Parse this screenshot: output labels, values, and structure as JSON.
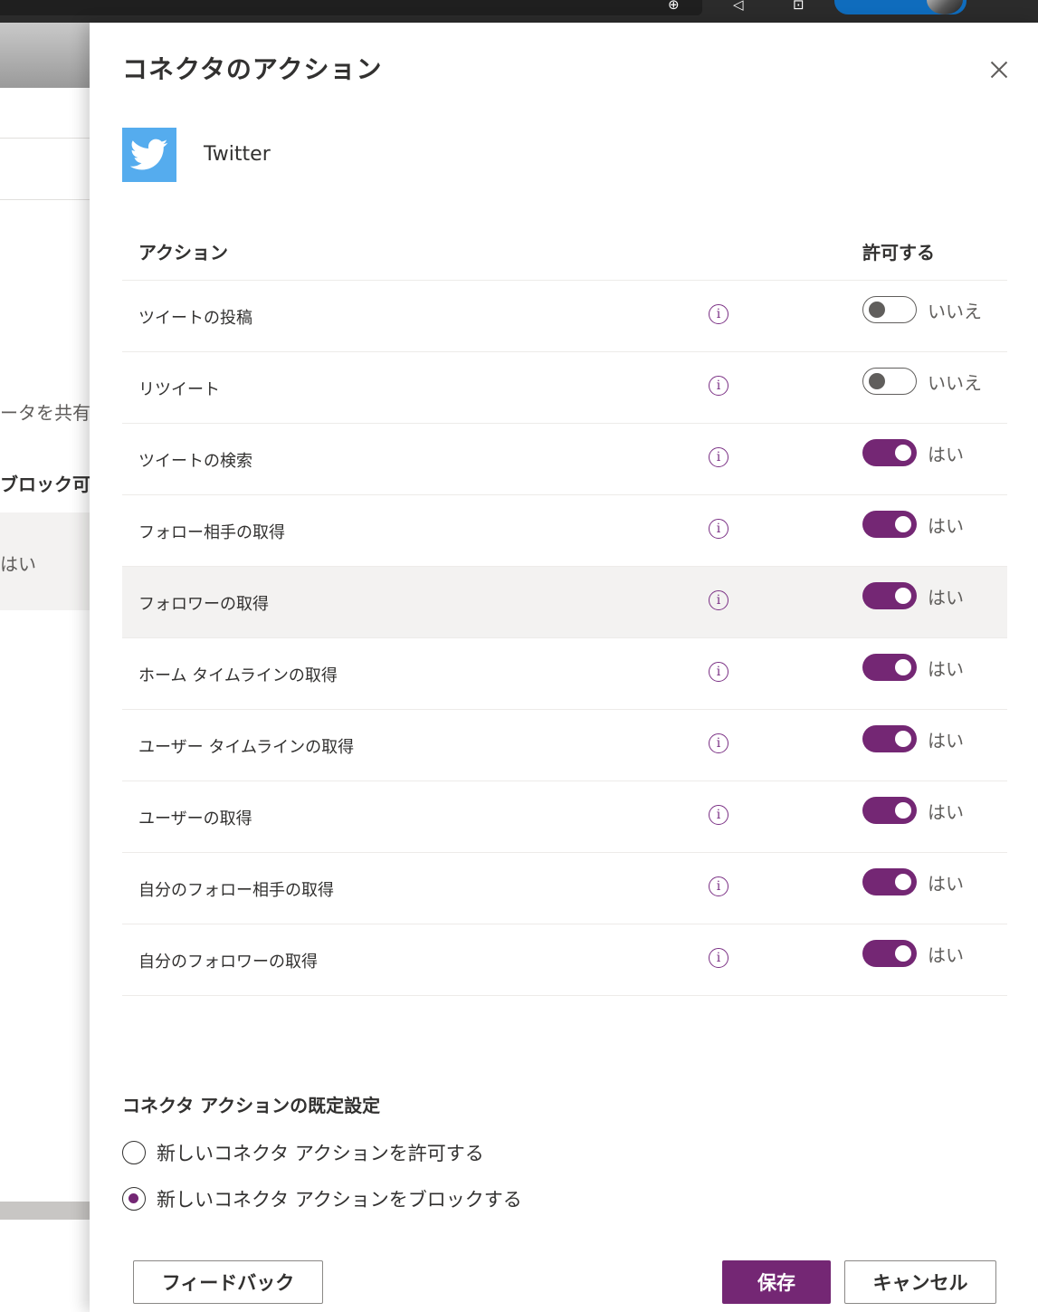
{
  "background": {
    "texts": [
      "ータを共有",
      "ブロック可",
      "はい"
    ]
  },
  "panel": {
    "title": "コネクタのアクション",
    "connector": {
      "name": "Twitter",
      "logo_icon": "twitter-bird-icon",
      "logo_color": "#55acee"
    },
    "table": {
      "header_action": "アクション",
      "header_allow": "許可する",
      "rows": [
        {
          "name": "ツイートの投稿",
          "allowed": false,
          "state_label": "いいえ"
        },
        {
          "name": "リツイート",
          "allowed": false,
          "state_label": "いいえ"
        },
        {
          "name": "ツイートの検索",
          "allowed": true,
          "state_label": "はい"
        },
        {
          "name": "フォロー相手の取得",
          "allowed": true,
          "state_label": "はい"
        },
        {
          "name": "フォロワーの取得",
          "allowed": true,
          "state_label": "はい"
        },
        {
          "name": "ホーム タイムラインの取得",
          "allowed": true,
          "state_label": "はい"
        },
        {
          "name": "ユーザー タイムラインの取得",
          "allowed": true,
          "state_label": "はい"
        },
        {
          "name": "ユーザーの取得",
          "allowed": true,
          "state_label": "はい"
        },
        {
          "name": "自分のフォロー相手の取得",
          "allowed": true,
          "state_label": "はい"
        },
        {
          "name": "自分のフォロワーの取得",
          "allowed": true,
          "state_label": "はい"
        }
      ]
    },
    "defaults": {
      "title": "コネクタ アクションの既定設定",
      "options": [
        {
          "label": "新しいコネクタ アクションを許可する",
          "selected": false
        },
        {
          "label": "新しいコネクタ アクションをブロックする",
          "selected": true
        }
      ]
    },
    "buttons": {
      "feedback": "フィードバック",
      "save": "保存",
      "cancel": "キャンセル"
    }
  },
  "colors": {
    "accent": "#742774",
    "toggle_off": "#605e5c"
  }
}
